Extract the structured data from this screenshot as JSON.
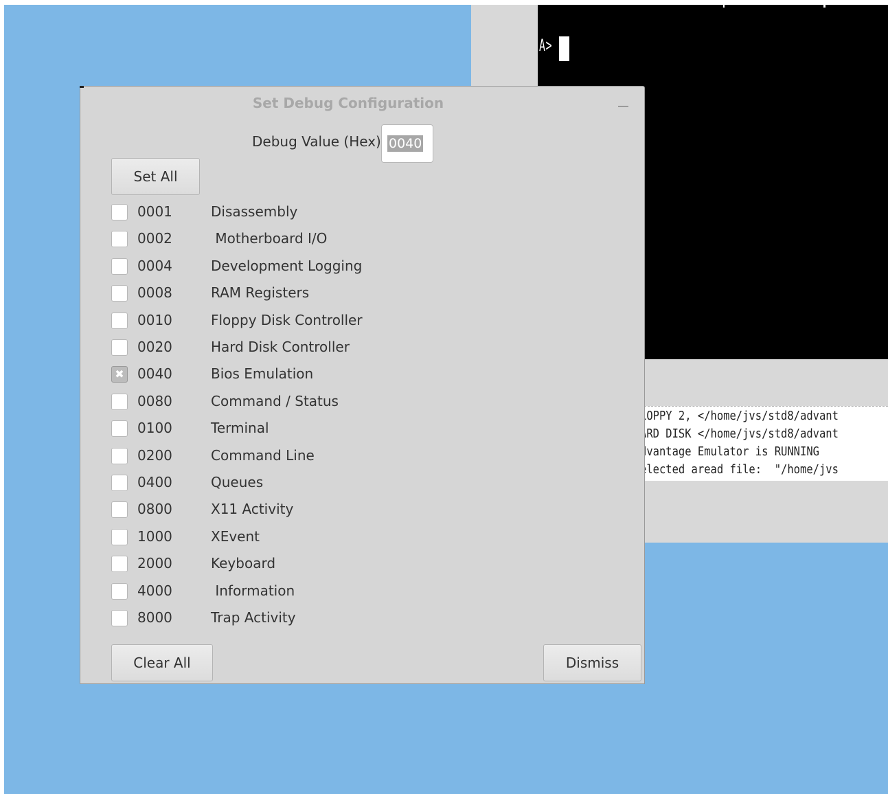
{
  "emulator": {
    "prompt": "A>",
    "log_lines": [
      "LOPPY 2, </home/jvs/std8/advant",
      "ARD DISK </home/jvs/std8/advant",
      "dvantage Emulator is RUNNING",
      "elected aread file:  \"/home/jvs"
    ]
  },
  "dialog": {
    "title": "Set Debug Configuration",
    "debug_label": "Debug Value (Hex)",
    "debug_value": "0040",
    "set_all_label": "Set All",
    "clear_all_label": "Clear All",
    "dismiss_label": "Dismiss",
    "items": [
      {
        "code": "0001",
        "label": "Disassembly",
        "checked": false
      },
      {
        "code": "0002",
        "label": " Motherboard I/O",
        "checked": false
      },
      {
        "code": "0004",
        "label": "Development Logging",
        "checked": false
      },
      {
        "code": "0008",
        "label": "RAM Registers",
        "checked": false
      },
      {
        "code": "0010",
        "label": "Floppy Disk Controller",
        "checked": false
      },
      {
        "code": "0020",
        "label": "Hard Disk Controller",
        "checked": false
      },
      {
        "code": "0040",
        "label": "Bios Emulation",
        "checked": true
      },
      {
        "code": "0080",
        "label": "Command / Status",
        "checked": false
      },
      {
        "code": "0100",
        "label": "Terminal",
        "checked": false
      },
      {
        "code": "0200",
        "label": "Command Line",
        "checked": false
      },
      {
        "code": "0400",
        "label": "Queues",
        "checked": false
      },
      {
        "code": "0800",
        "label": "X11 Activity",
        "checked": false
      },
      {
        "code": "1000",
        "label": "XEvent",
        "checked": false
      },
      {
        "code": "2000",
        "label": "Keyboard",
        "checked": false
      },
      {
        "code": "4000",
        "label": " Information",
        "checked": false
      },
      {
        "code": "8000",
        "label": "Trap Activity",
        "checked": false
      }
    ]
  },
  "colors": {
    "desktop": "#7db7e6",
    "dialog_bg": "#d6d6d6",
    "terminal_bg": "#000000"
  }
}
